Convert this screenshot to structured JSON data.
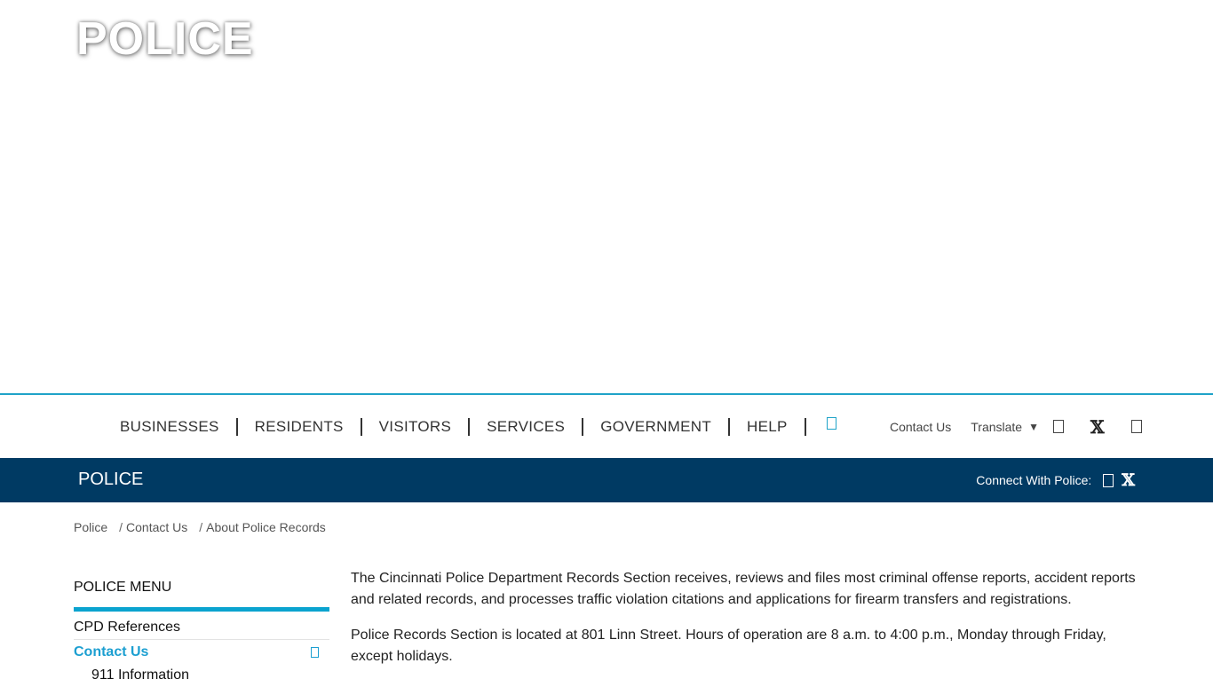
{
  "hero": {
    "title": "POLICE"
  },
  "main_nav": {
    "items": [
      "BUSINESSES",
      "RESIDENTS",
      "VISITORS",
      "SERVICES",
      "GOVERNMENT",
      "HELP"
    ],
    "search_icon": "search-icon"
  },
  "utility_nav": {
    "contact_label": "Contact Us",
    "translate_label": "Translate",
    "translate_caret": "▼",
    "icons": [
      "facebook-icon",
      "x-icon",
      "instagram-icon"
    ]
  },
  "department_banner": {
    "title": "POLICE",
    "connect_label": "Connect With Police:",
    "x_glyph": "𝕏"
  },
  "breadcrumb": [
    "Police",
    "Contact Us",
    "About Police Records"
  ],
  "breadcrumb_separator": "/",
  "side_menu": {
    "title": "POLICE MENU",
    "items": [
      {
        "label": "CPD References"
      },
      {
        "label": "Contact Us",
        "active": true
      },
      {
        "label": "911 Information",
        "sub": true
      }
    ]
  },
  "content": {
    "paragraphs": [
      "The Cincinnati Police Department Records Section receives, reviews and files most criminal offense reports, accident reports and related records, and processes traffic violation citations and applications for firearm transfers and registrations.",
      "Police Records Section is located at 801 Linn Street. Hours of operation are 8 a.m. to 4:00 p.m., Monday through Friday, except holidays."
    ]
  },
  "colors": {
    "accent": "#1fa3c8",
    "banner": "#003a63",
    "active_link": "#1c9fd1",
    "menu_bar": "#0aa3cf"
  }
}
